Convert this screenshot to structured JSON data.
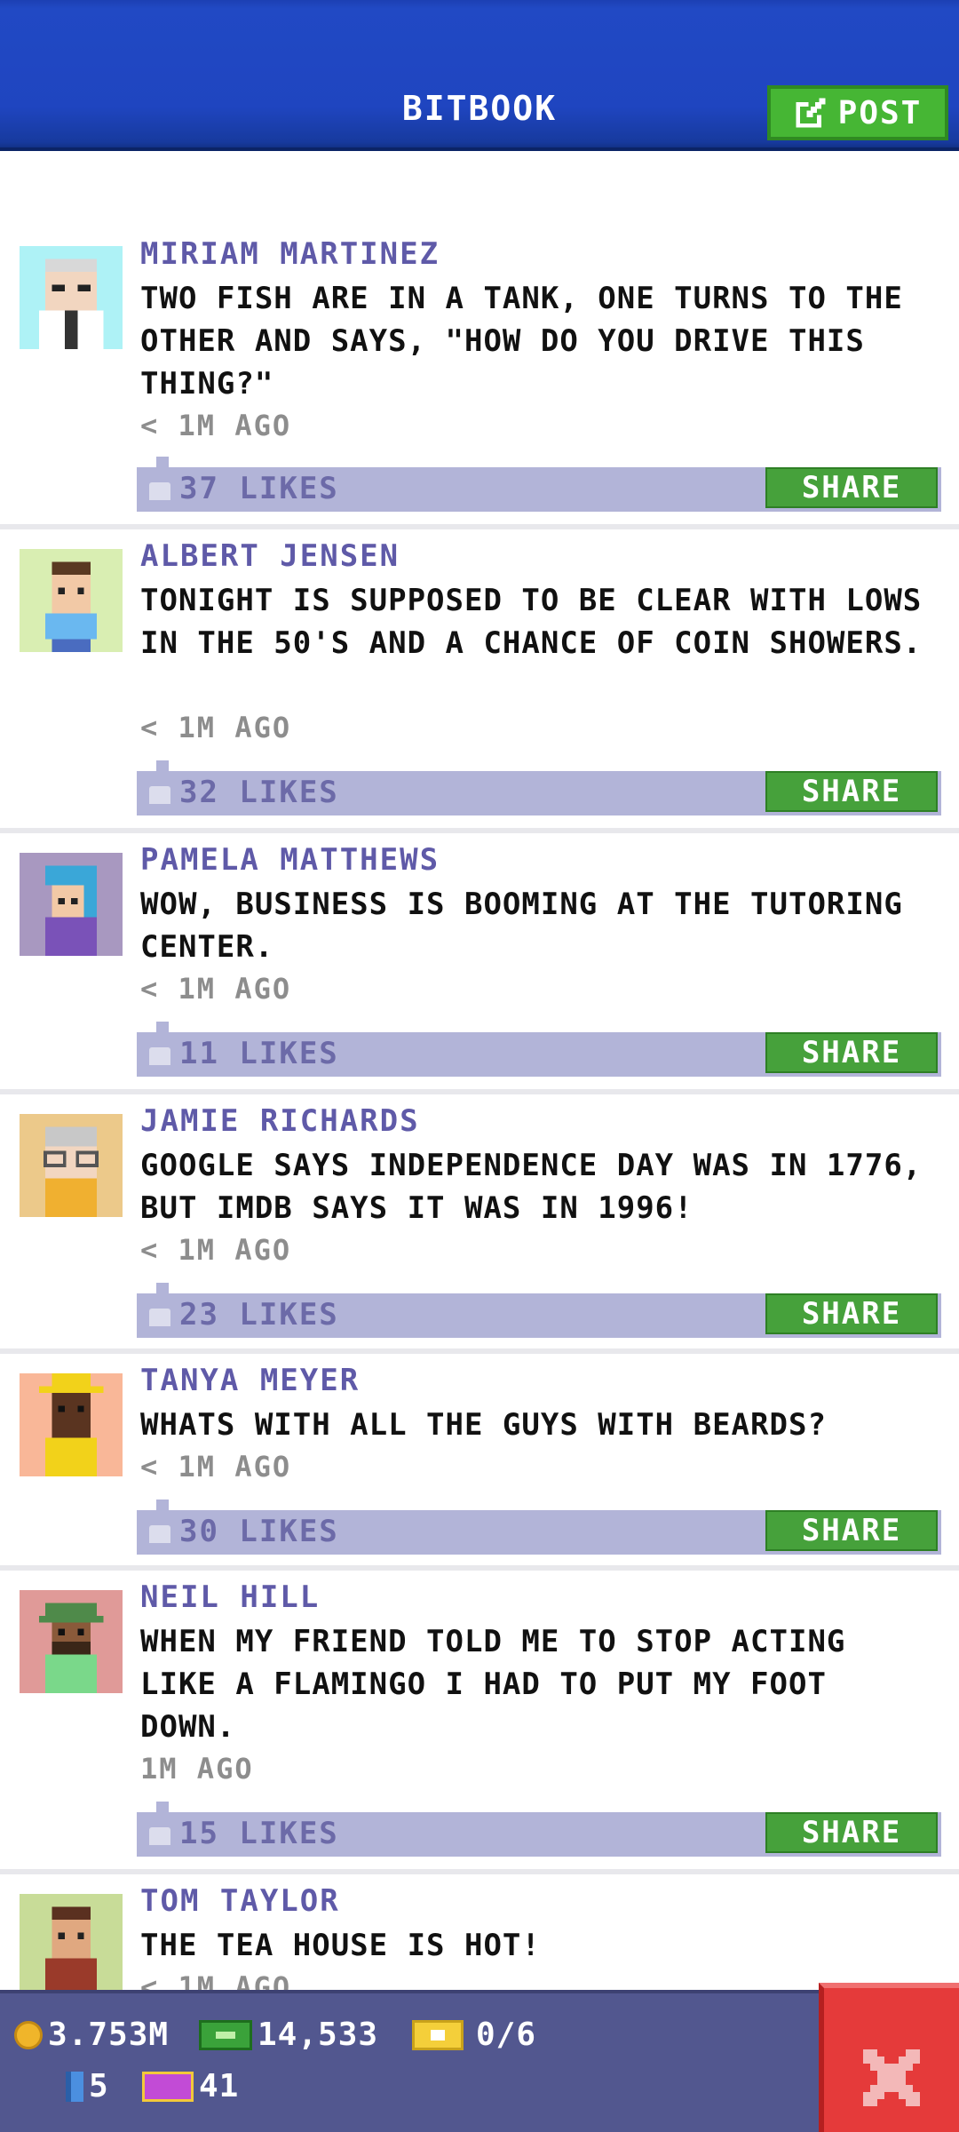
{
  "header": {
    "title": "BITBOOK",
    "post_label": "POST"
  },
  "posts": [
    {
      "name": "MIRIAM MARTINEZ",
      "text": "TWO FISH ARE IN A TANK, ONE TURNS TO THE OTHER AND SAYS, \"HOW DO YOU DRIVE THIS THING?\"",
      "time": "< 1M AGO",
      "likes": "37 LIKES",
      "share_label": "SHARE",
      "avatar_bg": "#aef2f6"
    },
    {
      "name": "ALBERT JENSEN",
      "text": "TONIGHT IS SUPPOSED TO BE CLEAR WITH LOWS IN THE 50'S AND A CHANCE OF COIN SHOWERS.",
      "time": "< 1M AGO",
      "likes": "32 LIKES",
      "share_label": "SHARE",
      "avatar_bg": "#d9eeb2"
    },
    {
      "name": "PAMELA MATTHEWS",
      "text": "WOW, BUSINESS IS BOOMING AT THE TUTORING CENTER.",
      "time": "< 1M AGO",
      "likes": "11 LIKES",
      "share_label": "SHARE",
      "avatar_bg": "#a898c0"
    },
    {
      "name": "JAMIE RICHARDS",
      "text": "GOOGLE SAYS INDEPENDENCE DAY WAS IN 1776, BUT IMDB SAYS IT WAS IN 1996!",
      "time": "< 1M AGO",
      "likes": "23 LIKES",
      "share_label": "SHARE",
      "avatar_bg": "#ecc98a"
    },
    {
      "name": "TANYA MEYER",
      "text": "WHATS WITH ALL THE GUYS WITH BEARDS?",
      "time": "< 1M AGO",
      "likes": "30 LIKES",
      "share_label": "SHARE",
      "avatar_bg": "#f9b798"
    },
    {
      "name": "NEIL HILL",
      "text": "WHEN MY FRIEND TOLD ME TO STOP ACTING LIKE A FLAMINGO I HAD TO PUT MY FOOT DOWN.",
      "time": "1M AGO",
      "likes": "15 LIKES",
      "share_label": "SHARE",
      "avatar_bg": "#e09a98"
    },
    {
      "name": "TOM TAYLOR",
      "text": "THE TEA HOUSE IS HOT!",
      "time": "< 1M AGO",
      "likes": "",
      "share_label": "",
      "avatar_bg": "#c8dc98"
    }
  ],
  "bottom_bar": {
    "coins": "3.753M",
    "bux": "14,533",
    "tickets": "0/6",
    "gems": "5",
    "vip": "41"
  },
  "colors": {
    "header_blue": "#1f45c0",
    "post_green": "#46b634",
    "name_purple": "#5f5aa8",
    "likes_bar": "#b2b4d8",
    "bottom_bar": "#52578f",
    "close_red": "#e53a3a"
  },
  "icons": {
    "post": "edit-icon",
    "like": "thumbs-up-icon",
    "coin": "coin-icon",
    "bux": "bux-icon",
    "ticket": "ticket-icon",
    "gem": "gem-icon",
    "vip": "vip-icon",
    "close": "close-icon"
  }
}
